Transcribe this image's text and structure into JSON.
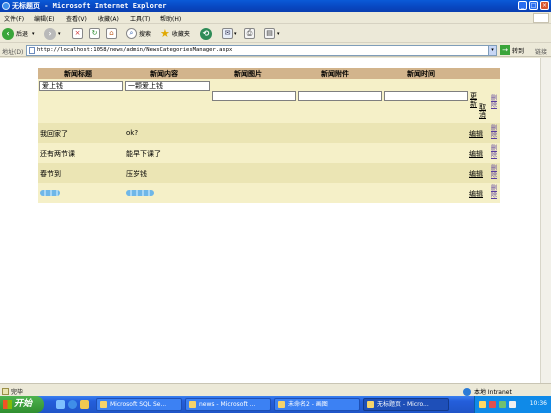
{
  "window": {
    "title": "无标题页 - Microsoft Internet Explorer",
    "controls": [
      "_",
      "□",
      "×"
    ]
  },
  "menu": {
    "items": [
      "文件(F)",
      "编辑(E)",
      "查看(V)",
      "收藏(A)",
      "工具(T)",
      "帮助(H)"
    ]
  },
  "toolbar": {
    "back_label": "后退",
    "search_label": "搜索",
    "favorites_label": "收藏夹"
  },
  "address": {
    "label": "地址(D)",
    "url": "http://localhost:1058/news/admin/NewsCategoriesManager.aspx",
    "go_label": "转到",
    "links_label": "链接"
  },
  "grid": {
    "headers": [
      "新闻标题",
      "新闻内容",
      "新闻图片",
      "新闻附件",
      "新闻时间"
    ],
    "edit_row": {
      "title_value": "爱上钱",
      "content_value": "一颗爱上钱",
      "picture_value": "",
      "attachment_value": "",
      "time_value": "",
      "update_label": "更新",
      "cancel_label": "取消",
      "delete_label": "删除"
    },
    "rows": [
      {
        "title": "我回家了",
        "content": "ok?",
        "edit_label": "编辑",
        "delete_label": "删除"
      },
      {
        "title": "还有两节课",
        "content": "能早下课了",
        "edit_label": "编辑",
        "delete_label": "删除"
      },
      {
        "title": "春节到",
        "content": "压岁钱",
        "edit_label": "编辑",
        "delete_label": "删除"
      },
      {
        "title": "",
        "content": "",
        "edit_label": "编辑",
        "delete_label": "删除"
      }
    ],
    "colors": {
      "header": "#d2b48c",
      "row_a": "#f5f0c8",
      "row_b": "#ebe5b4",
      "delete_link": "#5a3e9e"
    }
  },
  "status": {
    "left": "完毕",
    "zone": "本地 Intranet"
  },
  "taskbar": {
    "start_label": "开始",
    "tasks": [
      "Microsoft SQL Se...",
      "news - Microsoft ...",
      "未命名2 - 画图",
      "无标题页 - Micro..."
    ],
    "clock": "10:36"
  }
}
